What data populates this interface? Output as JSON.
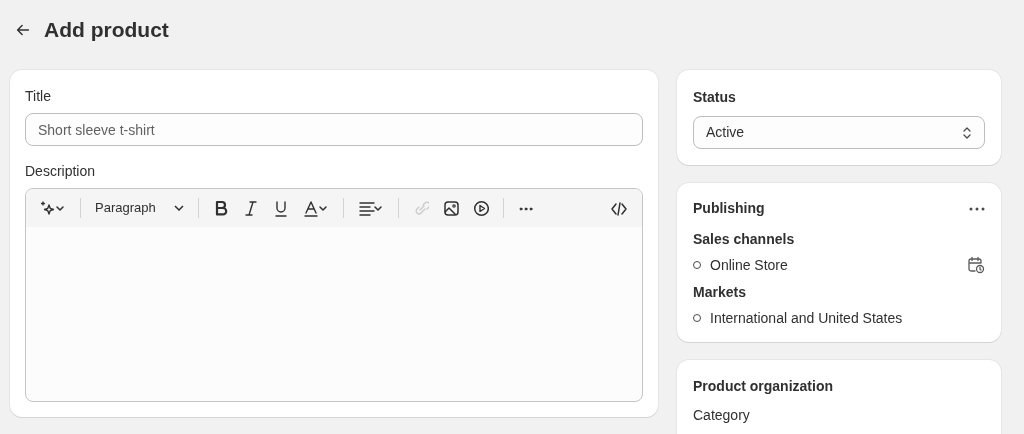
{
  "page": {
    "title": "Add product"
  },
  "product_card": {
    "title_label": "Title",
    "title_field": {
      "placeholder": "Short sleeve t-shirt"
    },
    "description_label": "Description",
    "toolbar": [
      {
        "kind": "ai",
        "disabled": false
      },
      {
        "kind": "separator"
      },
      {
        "kind": "paragraph",
        "label": "Paragraph",
        "disabled": false
      },
      {
        "kind": "separator"
      },
      {
        "kind": "bold",
        "disabled": false
      },
      {
        "kind": "italic",
        "disabled": false
      },
      {
        "kind": "underline",
        "disabled": false
      },
      {
        "kind": "text_color",
        "disabled": false
      },
      {
        "kind": "separator"
      },
      {
        "kind": "align",
        "disabled": false
      },
      {
        "kind": "separator"
      },
      {
        "kind": "link",
        "disabled": true
      },
      {
        "kind": "image",
        "disabled": false
      },
      {
        "kind": "video",
        "disabled": false
      },
      {
        "kind": "separator"
      },
      {
        "kind": "more",
        "disabled": false
      },
      {
        "kind": "spacer"
      },
      {
        "kind": "code",
        "disabled": false
      }
    ]
  },
  "status_card": {
    "heading": "Status",
    "select": {
      "value": "Active"
    }
  },
  "publishing_card": {
    "heading": "Publishing",
    "groups": [
      {
        "heading": "Sales channels",
        "items": [
          {
            "label": "Online Store",
            "schedule": true
          }
        ]
      },
      {
        "heading": "Markets",
        "items": [
          {
            "label": "International and United States",
            "schedule": false
          }
        ]
      }
    ]
  },
  "organization_card": {
    "heading": "Product organization",
    "field_label": "Category"
  }
}
